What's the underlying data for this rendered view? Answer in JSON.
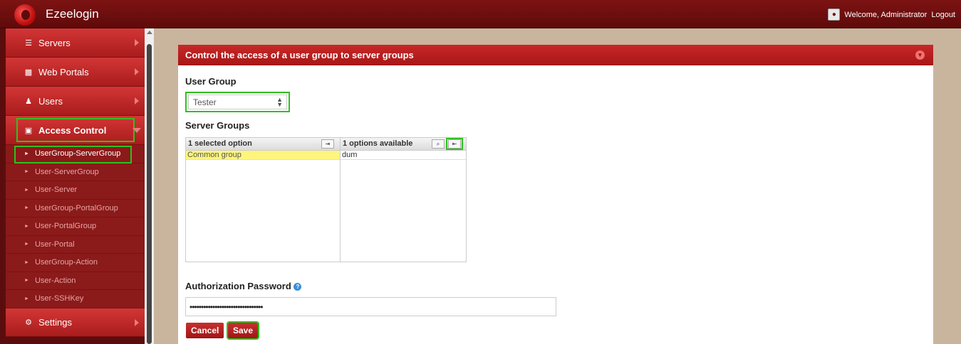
{
  "app": {
    "title": "Ezeelogin"
  },
  "header": {
    "welcome_text": "Welcome, Administrator",
    "logout_label": "Logout"
  },
  "sidebar": {
    "items": [
      {
        "label": "Servers",
        "icon": "list-icon"
      },
      {
        "label": "Web Portals",
        "icon": "dashboard-icon"
      },
      {
        "label": "Users",
        "icon": "users-icon"
      },
      {
        "label": "Access Control",
        "icon": "lock-icon"
      },
      {
        "label": "Settings",
        "icon": "gears-icon"
      }
    ],
    "sub_items": [
      {
        "label": "UserGroup-ServerGroup"
      },
      {
        "label": "User-ServerGroup"
      },
      {
        "label": "User-Server"
      },
      {
        "label": "UserGroup-PortalGroup"
      },
      {
        "label": "User-PortalGroup"
      },
      {
        "label": "User-Portal"
      },
      {
        "label": "UserGroup-Action"
      },
      {
        "label": "User-Action"
      },
      {
        "label": "User-SSHKey"
      }
    ]
  },
  "panel": {
    "title": "Control the access of a user group to server groups",
    "user_group_label": "User Group",
    "user_group_value": "Tester",
    "server_groups_label": "Server Groups",
    "selected_header": "1 selected option",
    "available_header": "1 options available",
    "selected_items": [
      "Common group"
    ],
    "available_items": [
      "dum"
    ],
    "auth_label": "Authorization Password",
    "password_value": "••••••••••••••••••••••••••••••••",
    "cancel_label": "Cancel",
    "save_label": "Save"
  }
}
